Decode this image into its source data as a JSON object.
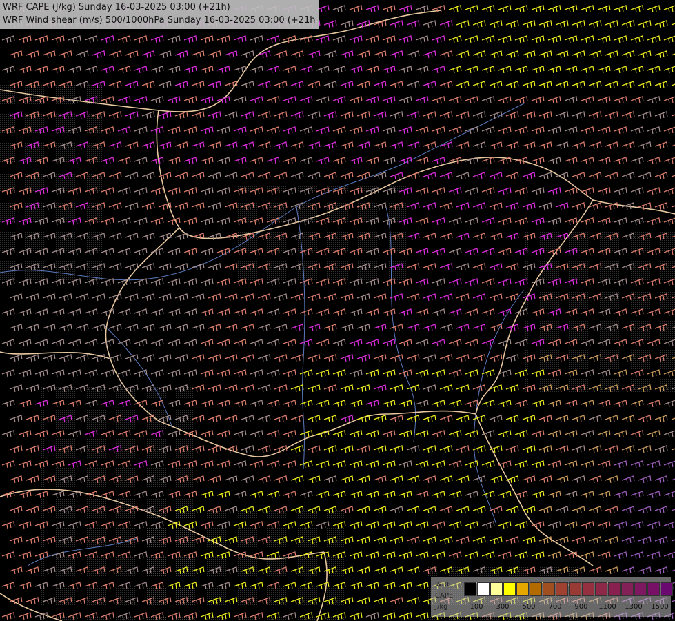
{
  "header": {
    "line1": "WRF CAPE (J/kg) Sunday 16-03-2025 03:00 (+21h)",
    "line2": "WRF Wind shear (m/s) 500/1000hPa Sunday 16-03-2025 03:00 (+21h)"
  },
  "legend": {
    "label_top": "WRF",
    "label_mid": "CAPE",
    "label_bottom": "J/kg",
    "tick_values": [
      "100",
      "300",
      "500",
      "700",
      "900",
      "1100",
      "1300",
      "1500"
    ],
    "colors": [
      "#000000",
      "#ffffff",
      "#ffff99",
      "#ffff00",
      "#e6a800",
      "#b36b00",
      "#a05020",
      "#a04030",
      "#9a3a35",
      "#943040",
      "#8e2848",
      "#882050",
      "#842058",
      "#7e1860",
      "#781068",
      "#6a0a70"
    ]
  },
  "barb_colors": {
    "gray": "#a89090",
    "salmon": "#e08070",
    "magenta": "#e030e0",
    "yellow": "#f0f020",
    "tan": "#d0a060",
    "violet": "#a060c0"
  },
  "map_colors": {
    "border": "#e8c8a0",
    "river": "#5a7abf",
    "background": "#000000"
  }
}
